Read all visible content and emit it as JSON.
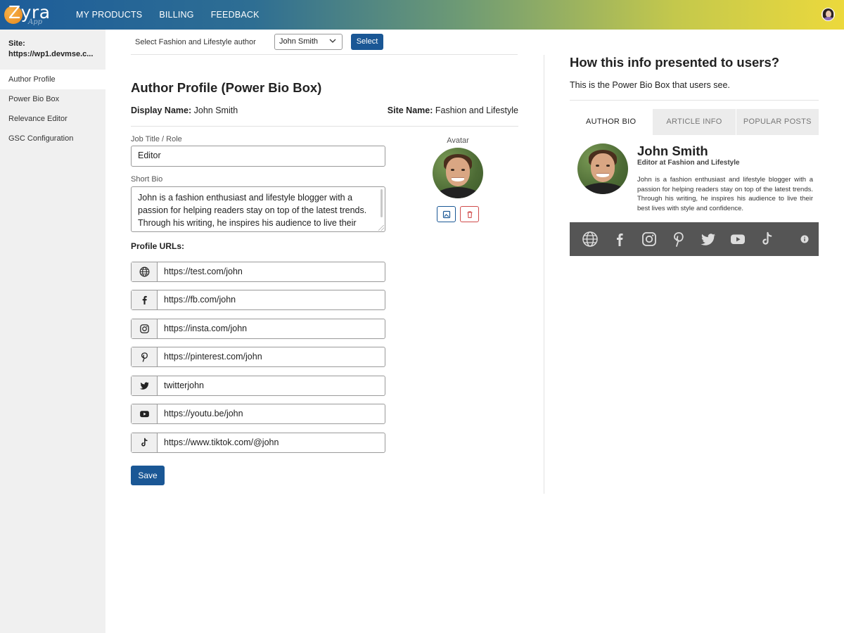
{
  "app": {
    "logo_text": "Zyra",
    "logo_sub": "App",
    "nav": [
      "MY PRODUCTS",
      "BILLING",
      "FEEDBACK"
    ]
  },
  "sidebar": {
    "site_label": "Site:",
    "site_url": "https://wp1.devmse.c...",
    "items": [
      "Author Profile",
      "Power Bio Box",
      "Relevance Editor",
      "GSC Configuration"
    ],
    "active_index": 0
  },
  "selector": {
    "label": "Select Fashion and Lifestyle author",
    "selected": "John Smith",
    "button": "Select"
  },
  "form": {
    "title": "Author Profile (Power Bio Box)",
    "display_name_label": "Display Name:",
    "display_name": "John Smith",
    "site_name_label": "Site Name:",
    "site_name": "Fashion and Lifestyle",
    "job_label": "Job Title / Role",
    "job_value": "Editor",
    "bio_label": "Short Bio",
    "bio_value": "John is a fashion enthusiast and lifestyle blogger with a passion for helping readers stay on top of the latest trends. Through his writing, he inspires his audience to live their best lives with style and confidence.",
    "avatar_label": "Avatar",
    "profile_urls_label": "Profile URLs:",
    "urls": [
      {
        "icon": "globe-icon",
        "value": "https://test.com/john"
      },
      {
        "icon": "facebook-icon",
        "value": "https://fb.com/john"
      },
      {
        "icon": "instagram-icon",
        "value": "https://insta.com/john"
      },
      {
        "icon": "pinterest-icon",
        "value": "https://pinterest.com/john"
      },
      {
        "icon": "twitter-icon",
        "value": "twitterjohn"
      },
      {
        "icon": "youtube-icon",
        "value": "https://youtu.be/john"
      },
      {
        "icon": "tiktok-icon",
        "value": "https://www.tiktok.com/@john"
      }
    ],
    "save": "Save"
  },
  "preview": {
    "title": "How this info presented to users?",
    "subtitle": "This is the Power Bio Box that users see.",
    "tabs": [
      "AUTHOR BIO",
      "ARTICLE INFO",
      "POPULAR POSTS"
    ],
    "active_tab": 0,
    "name": "John Smith",
    "role": "Editor at Fashion and Lifestyle",
    "bio": "John is a fashion enthusiast and lifestyle blogger with a passion for helping readers stay on top of the latest trends. Through his writing, he inspires his audience to live their best lives with style and confidence.",
    "social_icons": [
      "globe-icon",
      "facebook-icon",
      "instagram-icon",
      "pinterest-icon",
      "twitter-icon",
      "youtube-icon",
      "tiktok-icon",
      "info-icon"
    ]
  },
  "colors": {
    "primary_button": "#1a5795",
    "delete_red": "#d04a4a",
    "social_bar": "#555555"
  }
}
